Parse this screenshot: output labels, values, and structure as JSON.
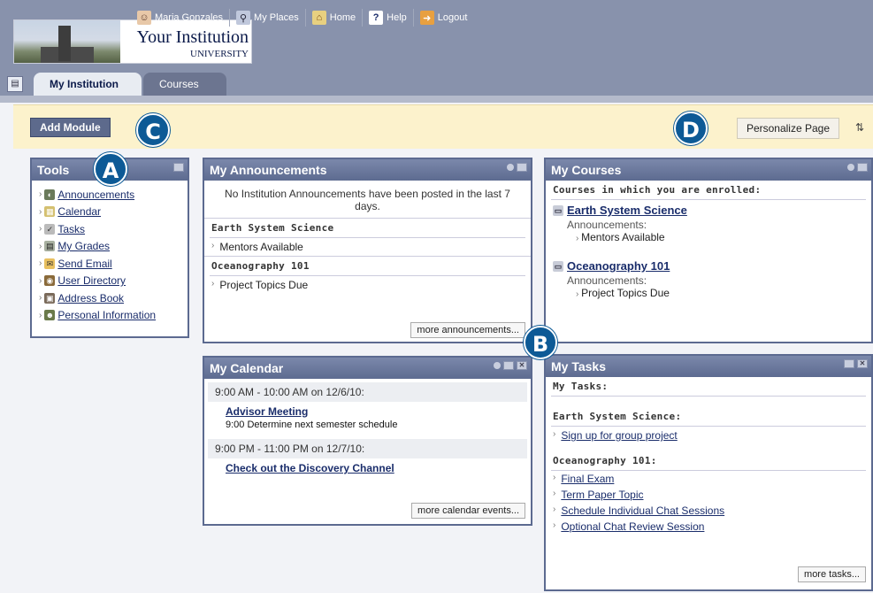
{
  "header": {
    "logo_line1": "Your Institution",
    "logo_line2": "UNIVERSITY",
    "nav": [
      {
        "label": "Maria Gonzales",
        "icon": "user-avatar-icon"
      },
      {
        "label": "My Places",
        "icon": "places-icon"
      },
      {
        "label": "Home",
        "icon": "home-icon"
      },
      {
        "label": "Help",
        "icon": "help-icon"
      },
      {
        "label": "Logout",
        "icon": "logout-icon"
      }
    ],
    "tabs": [
      {
        "label": "My Institution",
        "active": true
      },
      {
        "label": "Courses",
        "active": false
      }
    ]
  },
  "actionbar": {
    "add_module": "Add Module",
    "personalize": "Personalize Page",
    "sort_glyph": "⇅"
  },
  "badges": {
    "a": "A",
    "b": "B",
    "c": "C",
    "d": "D"
  },
  "tools": {
    "title": "Tools",
    "items": [
      "Announcements",
      "Calendar",
      "Tasks",
      "My Grades",
      "Send Email",
      "User Directory",
      "Address Book",
      "Personal Information"
    ]
  },
  "announcements": {
    "title": "My Announcements",
    "message": "No Institution Announcements have been posted in the last 7 days.",
    "course1": "Earth System Science",
    "course1_item": "Mentors Available",
    "course2": "Oceanography 101",
    "course2_item": "Project Topics Due",
    "more": "more announcements..."
  },
  "calendar": {
    "title": "My Calendar",
    "date1": "9:00 AM - 10:00 AM on 12/6/10:",
    "event1": "Advisor Meeting",
    "event1_sub": "9:00 Determine next semester schedule",
    "date2": "9:00 PM - 11:00 PM on 12/7/10:",
    "event2": "Check out the Discovery Channel",
    "more": "more calendar events..."
  },
  "courses": {
    "title": "My Courses",
    "subtitle": "Courses in which you are enrolled:",
    "c1": "Earth System Science",
    "c1_label": "Announcements:",
    "c1_item": "Mentors Available",
    "c2": "Oceanography 101",
    "c2_label": "Announcements:",
    "c2_item": "Project Topics Due"
  },
  "tasks": {
    "title": "My Tasks",
    "subtitle": "My Tasks:",
    "course1": "Earth System Science:",
    "course1_items": [
      "Sign up for group project"
    ],
    "course2": "Oceanography 101:",
    "course2_items": [
      "Final Exam",
      "Term Paper Topic",
      "Schedule Individual Chat Sessions",
      "Optional Chat Review Session"
    ],
    "more": "more tasks..."
  }
}
